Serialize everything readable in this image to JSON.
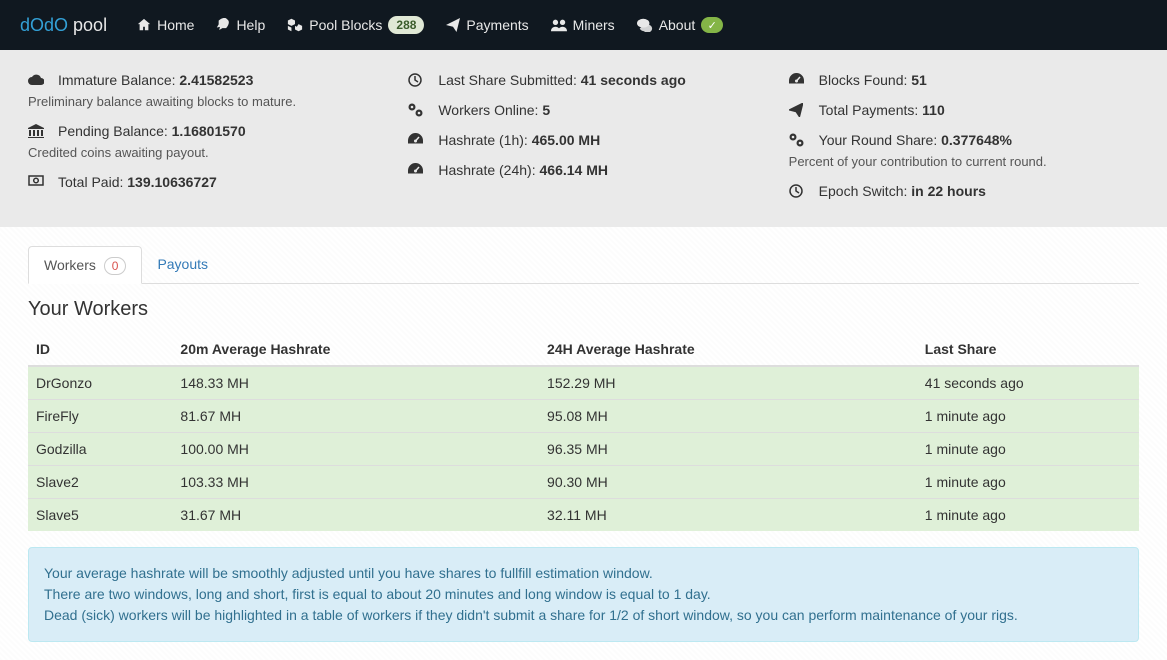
{
  "brand": {
    "part1": "dOdO",
    "part2": " pool"
  },
  "nav": {
    "home": "Home",
    "help": "Help",
    "blocks": "Pool Blocks",
    "blocks_count": "288",
    "payments": "Payments",
    "miners": "Miners",
    "about": "About"
  },
  "stats": {
    "immature_label": "Immature Balance: ",
    "immature_value": "2.41582523",
    "immature_sub": "Preliminary balance awaiting blocks to mature.",
    "pending_label": "Pending Balance: ",
    "pending_value": "1.16801570",
    "pending_sub": "Credited coins awaiting payout.",
    "paid_label": "Total Paid: ",
    "paid_value": "139.10636727",
    "last_share_label": "Last Share Submitted: ",
    "last_share_value": "41 seconds ago",
    "workers_label": "Workers Online: ",
    "workers_value": "5",
    "hr1_label": "Hashrate (1h): ",
    "hr1_value": "465.00 MH",
    "hr24_label": "Hashrate (24h): ",
    "hr24_value": "466.14 MH",
    "blocks_label": "Blocks Found: ",
    "blocks_value": "51",
    "payments_label": "Total Payments: ",
    "payments_value": "110",
    "share_label": "Your Round Share: ",
    "share_value": "0.377648%",
    "share_sub": "Percent of your contribution to current round.",
    "epoch_label": "Epoch Switch: ",
    "epoch_value": "in 22 hours"
  },
  "tabs": {
    "workers": "Workers",
    "workers_badge": "0",
    "payouts": "Payouts"
  },
  "workers": {
    "heading": "Your Workers",
    "cols": {
      "id": "ID",
      "h20": "20m Average Hashrate",
      "h24": "24H Average Hashrate",
      "last": "Last Share"
    },
    "rows": [
      {
        "id": "DrGonzo",
        "h20": "148.33 MH",
        "h24": "152.29 MH",
        "last": "41 seconds ago"
      },
      {
        "id": "FireFly",
        "h20": "81.67 MH",
        "h24": "95.08 MH",
        "last": "1 minute ago"
      },
      {
        "id": "Godzilla",
        "h20": "100.00 MH",
        "h24": "96.35 MH",
        "last": "1 minute ago"
      },
      {
        "id": "Slave2",
        "h20": "103.33 MH",
        "h24": "90.30 MH",
        "last": "1 minute ago"
      },
      {
        "id": "Slave5",
        "h20": "31.67 MH",
        "h24": "32.11 MH",
        "last": "1 minute ago"
      }
    ]
  },
  "info": {
    "l1": "Your average hashrate will be smoothly adjusted until you have shares to fullfill estimation window.",
    "l2": "There are two windows, long and short, first is equal to about 20 minutes and long window is equal to 1 day.",
    "l3": "Dead (sick) workers will be highlighted in a table of workers if they didn't submit a share for 1/2 of short window, so you can perform maintenance of your rigs."
  }
}
